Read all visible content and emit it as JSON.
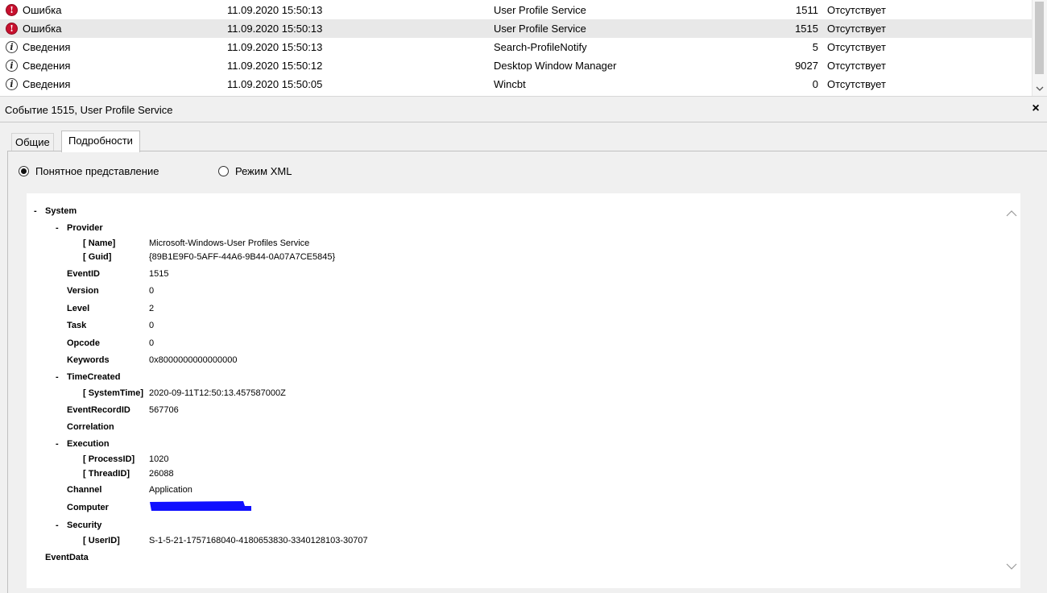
{
  "events": [
    {
      "level": "Ошибка",
      "type": "error",
      "date": "11.09.2020 15:50:13",
      "source": "User Profile Service",
      "id": "1511",
      "task": "Отсутствует",
      "selected": false
    },
    {
      "level": "Ошибка",
      "type": "error",
      "date": "11.09.2020 15:50:13",
      "source": "User Profile Service",
      "id": "1515",
      "task": "Отсутствует",
      "selected": true
    },
    {
      "level": "Сведения",
      "type": "info",
      "date": "11.09.2020 15:50:13",
      "source": "Search-ProfileNotify",
      "id": "5",
      "task": "Отсутствует",
      "selected": false
    },
    {
      "level": "Сведения",
      "type": "info",
      "date": "11.09.2020 15:50:12",
      "source": "Desktop Window Manager",
      "id": "9027",
      "task": "Отсутствует",
      "selected": false
    },
    {
      "level": "Сведения",
      "type": "info",
      "date": "11.09.2020 15:50:05",
      "source": "Wincbt",
      "id": "0",
      "task": "Отсутствует",
      "selected": false
    }
  ],
  "detail": {
    "title": "Событие 1515, User Profile Service",
    "close": "×",
    "tabs": [
      "Общие",
      "Подробности"
    ],
    "view_modes": {
      "friendly": "Понятное представление",
      "xml": "Режим XML",
      "selected": "friendly"
    }
  },
  "tree": {
    "collapse_symbol": "-",
    "system": "System",
    "provider": "Provider",
    "name_key": "[ Name]",
    "name_val": "Microsoft-Windows-User Profiles Service",
    "guid_key": "[ Guid]",
    "guid_val": "{89B1E9F0-5AFF-44A6-9B44-0A07A7CE5845}",
    "eventid_key": "EventID",
    "eventid_val": "1515",
    "version_key": "Version",
    "version_val": "0",
    "level_key": "Level",
    "level_val": "2",
    "task_key": "Task",
    "task_val": "0",
    "opcode_key": "Opcode",
    "opcode_val": "0",
    "keywords_key": "Keywords",
    "keywords_val": "0x8000000000000000",
    "timecreated": "TimeCreated",
    "systemtime_key": "[ SystemTime]",
    "systemtime_val": "2020-09-11T12:50:13.457587000Z",
    "recordid_key": "EventRecordID",
    "recordid_val": "567706",
    "correlation": "Correlation",
    "execution": "Execution",
    "processid_key": "[ ProcessID]",
    "processid_val": "1020",
    "threadid_key": "[ ThreadID]",
    "threadid_val": "26088",
    "channel_key": "Channel",
    "channel_val": "Application",
    "computer_key": "Computer",
    "security": "Security",
    "userid_key": "[ UserID]",
    "userid_val": "S-1-5-21-1757168040-4180653830-3340128103-30707",
    "eventdata": "EventData"
  },
  "colors": {
    "error": "#c8102e",
    "selected_row": "#e8e8e8",
    "redaction": "#1010ff"
  },
  "icons": {
    "error": "error-icon",
    "info": "info-icon",
    "close": "close-icon"
  }
}
